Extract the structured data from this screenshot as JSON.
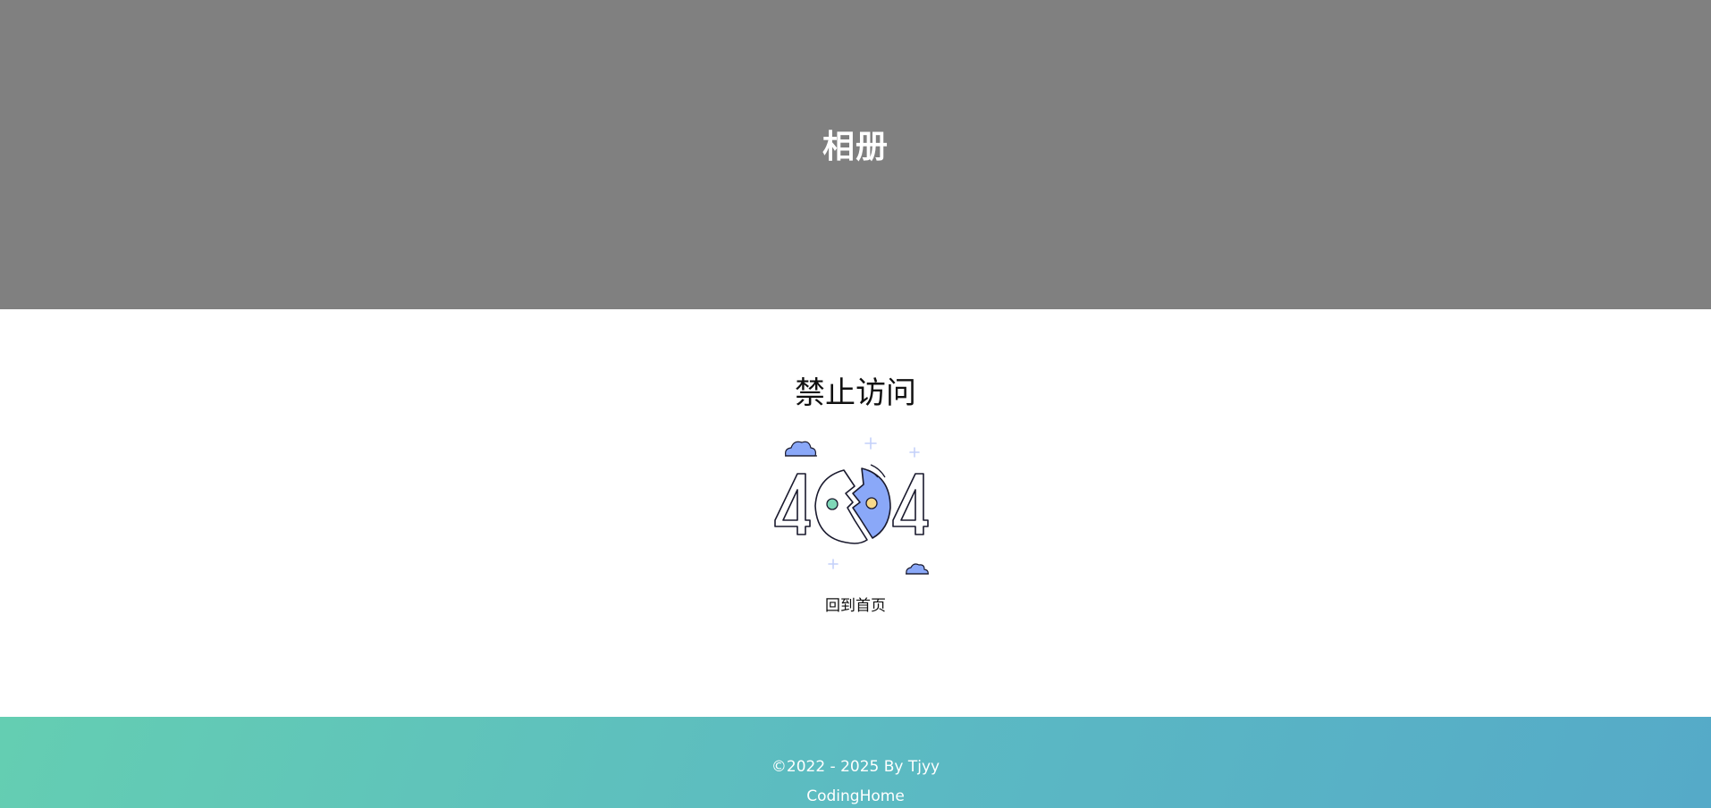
{
  "hero": {
    "title": "相册",
    "background_color": "#808080"
  },
  "main": {
    "error_title": "禁止访问",
    "illustration_icon": "404-broken-planet-icon",
    "home_link_label": "回到首页"
  },
  "footer": {
    "copyright": "©2022 - 2025 By Tjyy",
    "site_name": "CodingHome",
    "gradient_colors": [
      "#64ceb2",
      "#55aac8"
    ]
  },
  "colors": {
    "accent_blue": "#8aa8f8",
    "accent_green": "#7fd8b8",
    "accent_yellow": "#f7d98a"
  }
}
